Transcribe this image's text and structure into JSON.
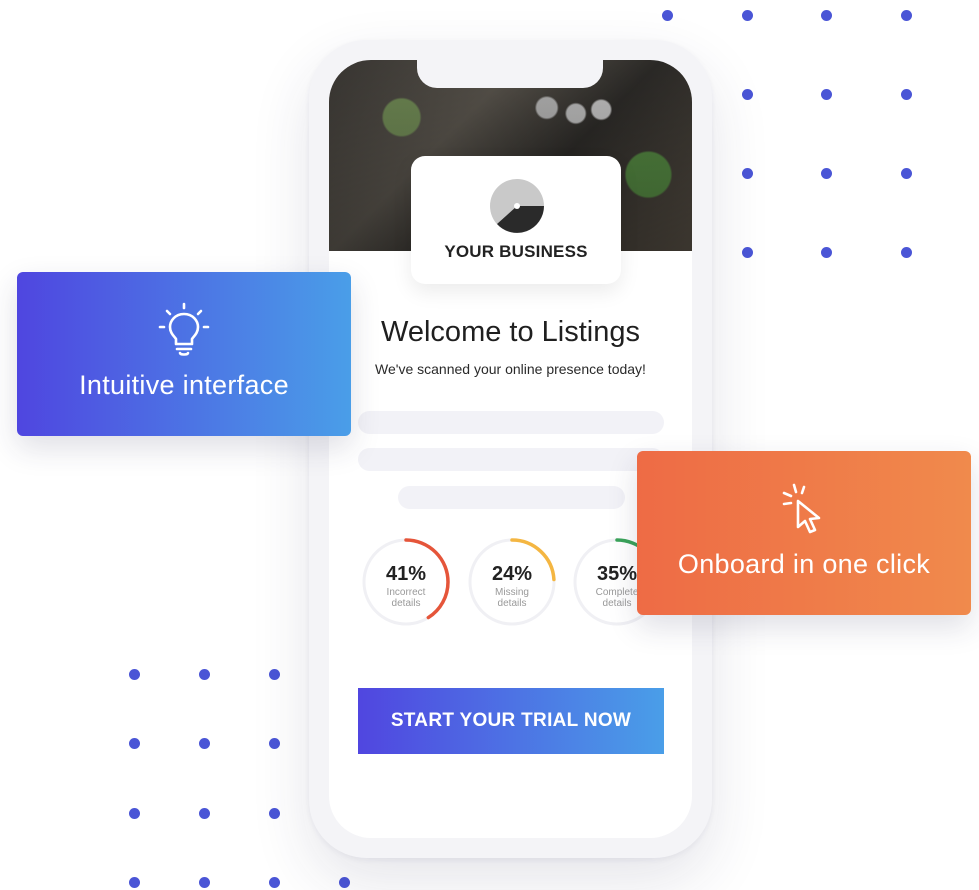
{
  "colors": {
    "accent_blue": "#4f46e0",
    "accent_light_blue": "#4a9ee8",
    "accent_orange": "#ee6b45",
    "dot": "#4a55d6",
    "incorrect": "#e5553a",
    "missing": "#f4b642",
    "complete": "#3aa35a"
  },
  "business": {
    "name": "YOUR BUSINESS",
    "logo_icon": "half-circle-logo"
  },
  "welcome": {
    "title": "Welcome to Listings",
    "subtitle": "We've scanned your online presence today!"
  },
  "stats": [
    {
      "percent": 41,
      "label": "41%",
      "line1": "Incorrect",
      "line2": "details"
    },
    {
      "percent": 24,
      "label": "24%",
      "line1": "Missing",
      "line2": "details"
    },
    {
      "percent": 35,
      "label": "35%",
      "line1": "Complete",
      "line2": "details"
    }
  ],
  "cta": {
    "label": "START YOUR TRIAL NOW"
  },
  "features": {
    "intuitive": {
      "text": "Intuitive interface",
      "icon": "lightbulb-icon"
    },
    "onboard": {
      "text": "Onboard in one click",
      "icon": "cursor-click-icon"
    }
  }
}
